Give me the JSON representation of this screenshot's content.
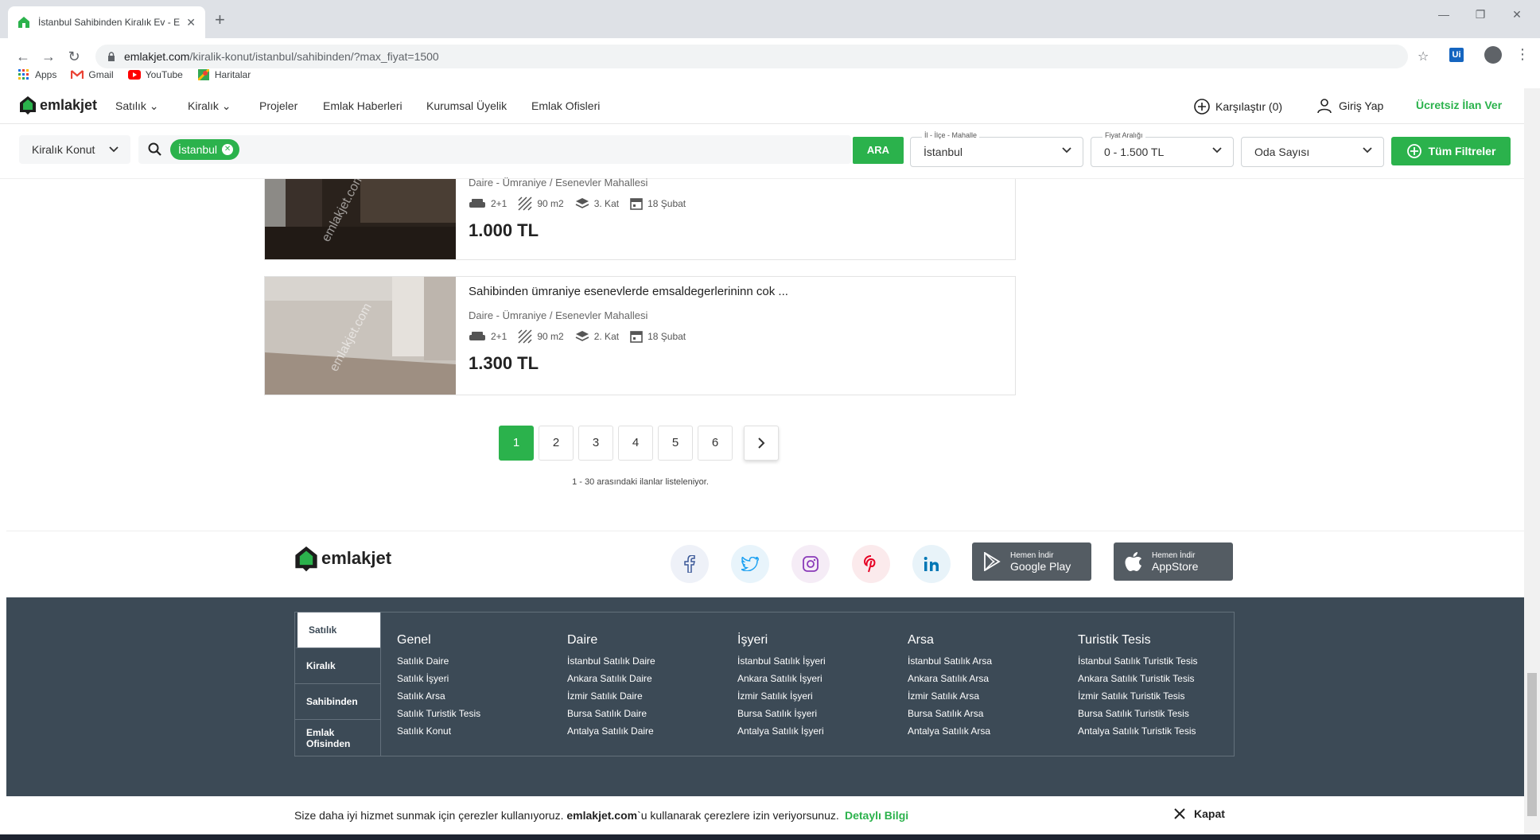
{
  "browser": {
    "tab_title": "İstanbul Sahibinden Kiralık Ev - E",
    "url_host": "emlakjet.com",
    "url_path": "/kiralik-konut/istanbul/sahibinden/?max_fiyat=1500",
    "bookmarks": [
      {
        "label": "Apps"
      },
      {
        "label": "Gmail"
      },
      {
        "label": "YouTube"
      },
      {
        "label": "Haritalar"
      }
    ],
    "extension_label": "Ui"
  },
  "header": {
    "logo": "emlakjet",
    "nav": [
      "Satılık",
      "Kiralık",
      "Projeler",
      "Emlak Haberleri",
      "Kurumsal Üyelik",
      "Emlak Ofisleri"
    ],
    "compare": "Karşılaştır (0)",
    "login": "Giriş Yap",
    "free_ad": "Ücretsiz İlan Ver"
  },
  "filters": {
    "type": "Kiralık Konut",
    "chip": "İstanbul",
    "search_button": "ARA",
    "location_label": "İl - İlçe - Mahalle",
    "location_value": "İstanbul",
    "price_label": "Fiyat Aralığı",
    "price_value": "0 - 1.500 TL",
    "rooms": "Oda Sayısı",
    "all_filters": "Tüm Filtreler"
  },
  "listings": [
    {
      "title": "",
      "location": "Daire - Ümraniye / Esenevler Mahallesi",
      "rooms": "2+1",
      "area": "90 m2",
      "floor": "3. Kat",
      "date": "18 Şubat",
      "price": "1.000 TL",
      "watermark": "emlakjet.com"
    },
    {
      "title": "Sahibinden ümraniye esenevlerde emsaldegerlerininn cok ...",
      "location": "Daire - Ümraniye / Esenevler Mahallesi",
      "rooms": "2+1",
      "area": "90 m2",
      "floor": "2. Kat",
      "date": "18 Şubat",
      "price": "1.300 TL",
      "watermark": "emlakjet.com"
    }
  ],
  "pagination": {
    "pages": [
      "1",
      "2",
      "3",
      "4",
      "5",
      "6"
    ],
    "active": "1",
    "next": "›",
    "range_text": "1 - 30 arasındaki ilanlar listeleniyor."
  },
  "footer": {
    "logo": "emlakjet",
    "stores": [
      {
        "line1": "Hemen İndir",
        "line2": "Google Play"
      },
      {
        "line1": "Hemen İndir",
        "line2": "AppStore"
      }
    ],
    "tabs": [
      "Satılık",
      "Kiralık",
      "Sahibinden",
      "Emlak Ofisinden"
    ],
    "columns": [
      {
        "title": "Genel",
        "links": [
          "Satılık Daire",
          "Satılık İşyeri",
          "Satılık Arsa",
          "Satılık Turistik Tesis",
          "Satılık Konut"
        ]
      },
      {
        "title": "Daire",
        "links": [
          "İstanbul Satılık Daire",
          "Ankara Satılık Daire",
          "İzmir Satılık Daire",
          "Bursa Satılık Daire",
          "Antalya Satılık Daire"
        ]
      },
      {
        "title": "İşyeri",
        "links": [
          "İstanbul Satılık İşyeri",
          "Ankara Satılık İşyeri",
          "İzmir Satılık İşyeri",
          "Bursa Satılık İşyeri",
          "Antalya Satılık İşyeri"
        ]
      },
      {
        "title": "Arsa",
        "links": [
          "İstanbul Satılık Arsa",
          "Ankara Satılık Arsa",
          "İzmir Satılık Arsa",
          "Bursa Satılık Arsa",
          "Antalya Satılık Arsa"
        ]
      },
      {
        "title": "Turistik Tesis",
        "links": [
          "İstanbul Satılık Turistik Tesis",
          "Ankara Satılık Turistik Tesis",
          "İzmir Satılık Turistik Tesis",
          "Bursa Satılık Turistik Tesis",
          "Antalya Satılık Turistik Tesis"
        ]
      }
    ]
  },
  "cookie": {
    "text_before": "Size daha iyi hizmet sunmak için çerezler kullanıyoruz. ",
    "brand": "emlakjet.com",
    "text_after": "`u kullanarak çerezlere izin veriyorsunuz.",
    "more": "Detaylı Bilgi",
    "close": "Kapat"
  },
  "colors": {
    "brand_green": "#2bb24c",
    "footer_dark": "#3c4a56"
  }
}
